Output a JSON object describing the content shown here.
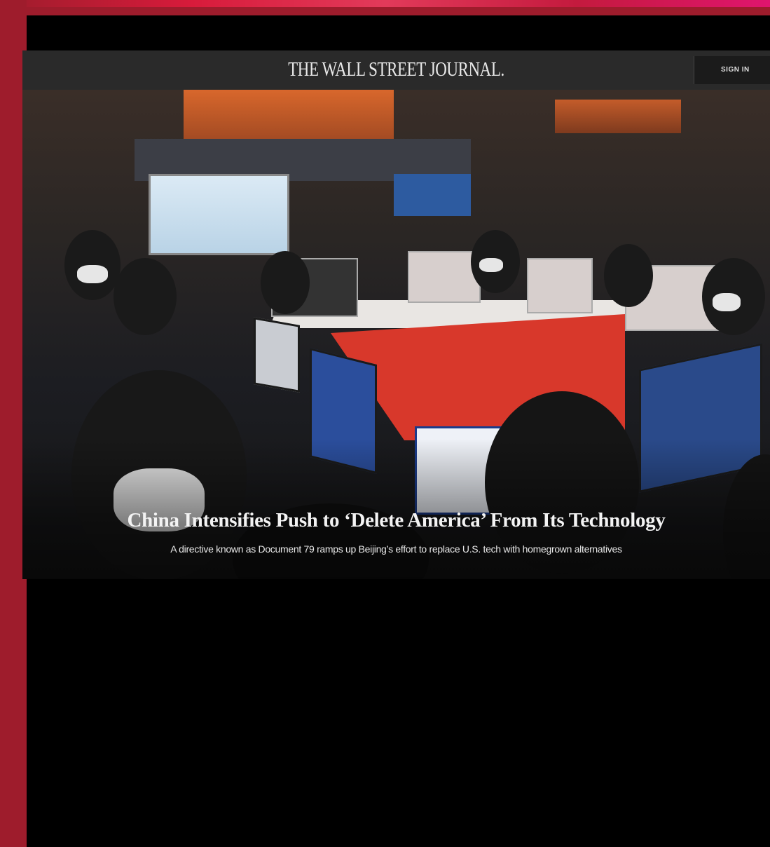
{
  "brand": {
    "logo_text": "THE WALL STREET JOURNAL.",
    "sign_in_label": "SIGN IN"
  },
  "article": {
    "headline": "China Intensifies Push to ‘Delete America’ From Its Technology",
    "dek": "A directive known as Document 79 ramps up Beijing’s effort to replace U.S. tech with homegrown alternatives"
  },
  "colors": {
    "side_band": "#9e1c2c",
    "masthead_bg": "#2a2a2a",
    "page_bg": "#000000"
  }
}
